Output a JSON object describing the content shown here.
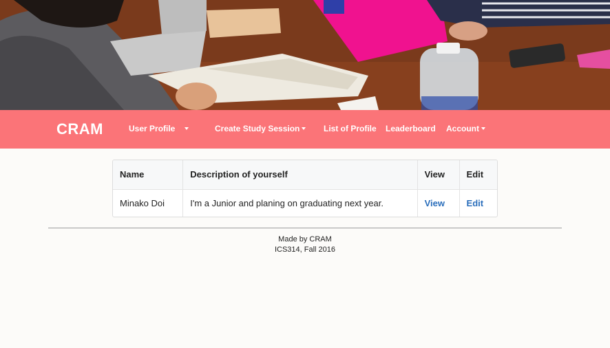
{
  "navbar": {
    "brand": "CRAM",
    "items": [
      {
        "label": "User Profile",
        "dropdown": true
      },
      {
        "label": "Create Study Session",
        "dropdown": true
      },
      {
        "label": "List of Profile",
        "dropdown": false
      },
      {
        "label": "Leaderboard",
        "dropdown": false
      },
      {
        "label": "Account",
        "dropdown": true
      }
    ]
  },
  "table": {
    "headers": [
      "Name",
      "Description of yourself",
      "View",
      "Edit"
    ],
    "rows": [
      {
        "name": "Minako Doi",
        "description": "I'm a Junior and planing on graduating next year.",
        "view": "View",
        "edit": "Edit"
      }
    ]
  },
  "footer": {
    "line1": "Made by CRAM",
    "line2": "ICS314, Fall 2016"
  },
  "colors": {
    "navbar_bg": "#fb7478",
    "link": "#2a6ebb",
    "page_bg": "#fcfbf9"
  }
}
